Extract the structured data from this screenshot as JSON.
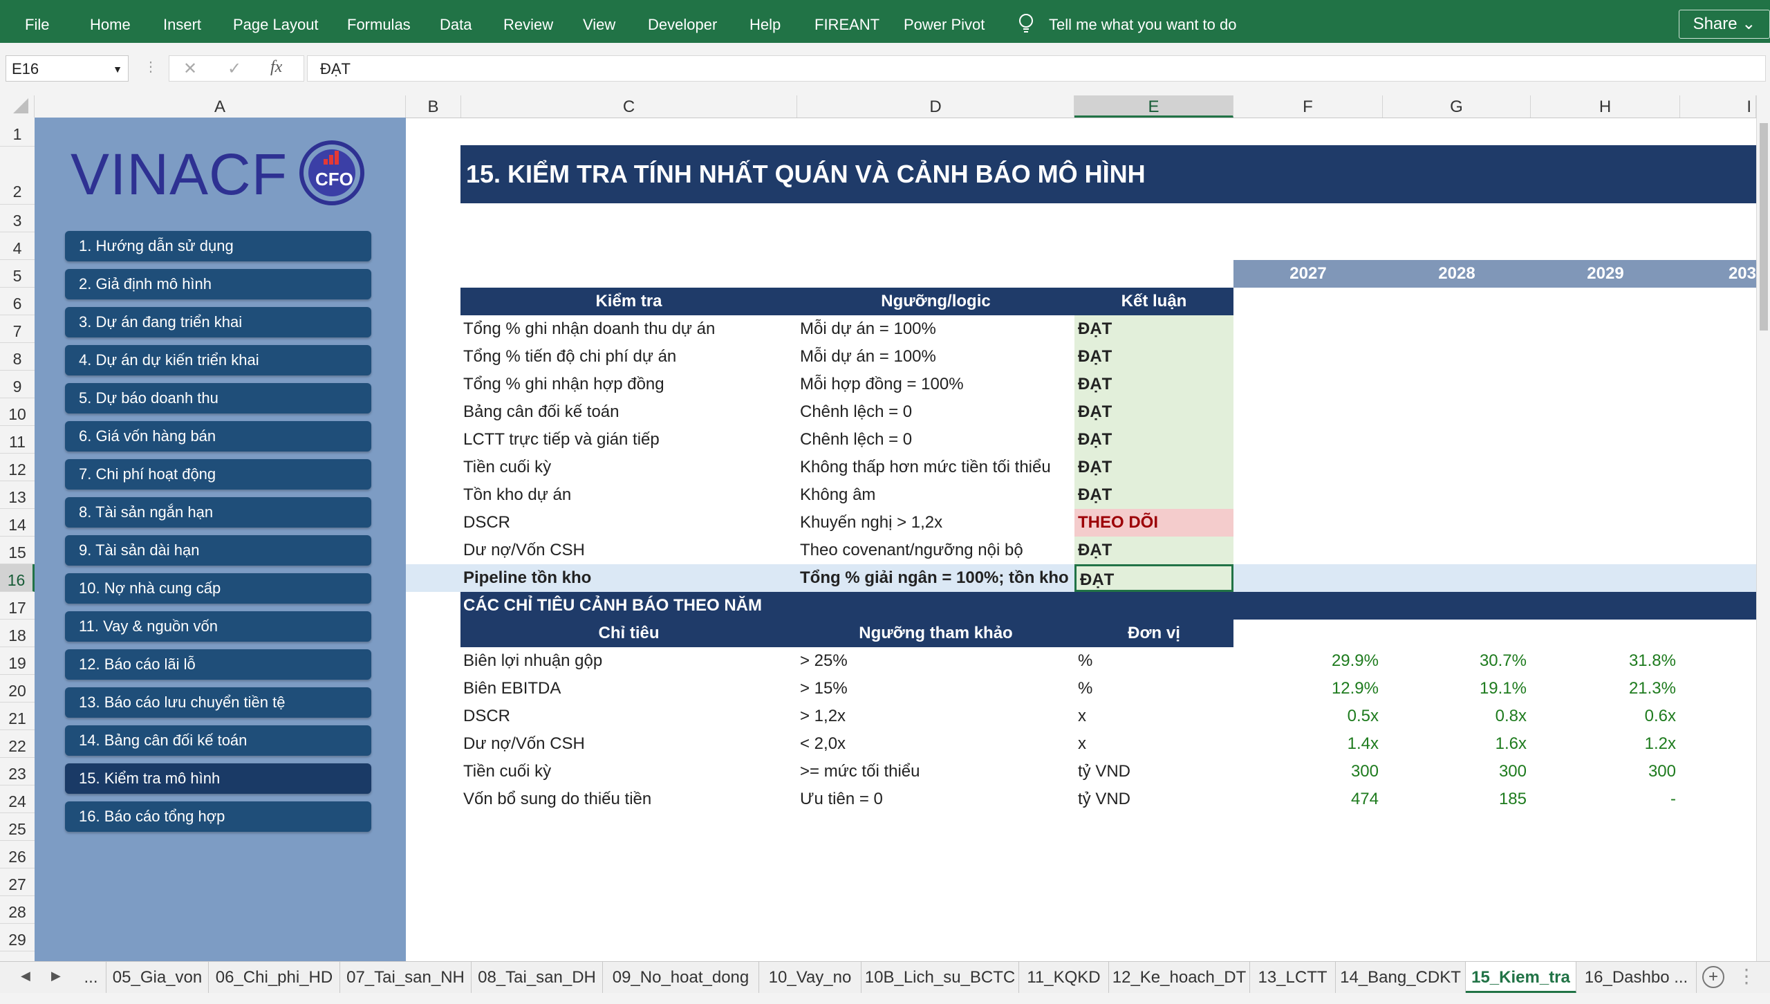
{
  "ribbon": {
    "tabs": [
      "File",
      "Home",
      "Insert",
      "Page Layout",
      "Formulas",
      "Data",
      "Review",
      "View",
      "Developer",
      "Help",
      "FIREANT",
      "Power Pivot"
    ],
    "tell_me": "Tell me what you want to do",
    "share": "Share"
  },
  "formula_bar": {
    "name_box": "E16",
    "fx": "fx",
    "value": "ĐẠT"
  },
  "columns": [
    "A",
    "B",
    "C",
    "D",
    "E",
    "F",
    "G",
    "H",
    "I"
  ],
  "rows": [
    "1",
    "2",
    "3",
    "4",
    "5",
    "6",
    "7",
    "8",
    "9",
    "10",
    "11",
    "12",
    "13",
    "14",
    "15",
    "16",
    "17",
    "18",
    "19",
    "20",
    "21",
    "22",
    "23",
    "24",
    "25",
    "26",
    "27",
    "28",
    "29"
  ],
  "sidebar": {
    "logo": "VINACF",
    "logo_badge": "CFO",
    "items": [
      "1. Hướng dẫn sử dụng",
      "2. Giả định mô hình",
      "3. Dự án đang triển khai",
      "4. Dự án dự kiến triển khai",
      "5. Dự báo doanh thu",
      "6. Giá vốn hàng bán",
      "7. Chi phí hoạt động",
      "8. Tài sản ngắn hạn",
      "9. Tài sản dài hạn",
      "10. Nợ nhà cung cấp",
      "11. Vay & nguồn vốn",
      "12. Báo cáo lãi lỗ",
      "13. Báo cáo lưu chuyển tiền tệ",
      "14. Bảng cân đối kế toán",
      "15. Kiểm tra mô hình",
      "16. Báo cáo tổng hợp"
    ]
  },
  "sheet": {
    "title": "15. KIỂM TRA TÍNH NHẤT QUÁN VÀ CẢNH BÁO MÔ HÌNH",
    "years": [
      "2027",
      "2028",
      "2029",
      "203"
    ],
    "check_headers": [
      "Kiểm tra",
      "Ngưỡng/logic",
      "Kết luận"
    ],
    "checks": [
      {
        "name": "Tổng % ghi nhận doanh thu dự án",
        "logic": "Mỗi dự án = 100%",
        "result": "ĐẠT"
      },
      {
        "name": "Tổng % tiến độ chi phí dự án",
        "logic": "Mỗi dự án = 100%",
        "result": "ĐẠT"
      },
      {
        "name": "Tổng % ghi nhận hợp đồng",
        "logic": "Mỗi hợp đồng = 100%",
        "result": "ĐẠT"
      },
      {
        "name": "Bảng cân đối kế toán",
        "logic": "Chênh lệch = 0",
        "result": "ĐẠT"
      },
      {
        "name": "LCTT trực tiếp và gián tiếp",
        "logic": "Chênh lệch = 0",
        "result": "ĐẠT"
      },
      {
        "name": "Tiền cuối kỳ",
        "logic": "Không thấp hơn mức tiền tối thiểu",
        "result": "ĐẠT"
      },
      {
        "name": "Tồn kho dự án",
        "logic": "Không âm",
        "result": "ĐẠT"
      },
      {
        "name": "DSCR",
        "logic": "Khuyến nghị > 1,2x",
        "result": "THEO DÕI"
      },
      {
        "name": "Dư nợ/Vốn CSH",
        "logic": "Theo covenant/ngưỡng nội bộ",
        "result": "ĐẠT"
      },
      {
        "name": "Pipeline tồn kho",
        "logic": "Tổng % giải ngân = 100%; tồn kho",
        "result": "ĐẠT"
      }
    ],
    "warning_title": "CÁC CHỈ TIÊU CẢNH BÁO THEO NĂM",
    "warning_headers": [
      "Chỉ tiêu",
      "Ngưỡng tham khảo",
      "Đơn vị"
    ],
    "warnings": [
      {
        "name": "Biên lợi nhuận gộp",
        "threshold": "> 25%",
        "unit": "%",
        "v": [
          "29.9%",
          "30.7%",
          "31.8%"
        ]
      },
      {
        "name": "Biên EBITDA",
        "threshold": "> 15%",
        "unit": "%",
        "v": [
          "12.9%",
          "19.1%",
          "21.3%"
        ]
      },
      {
        "name": "DSCR",
        "threshold": "> 1,2x",
        "unit": "x",
        "v": [
          "0.5x",
          "0.8x",
          "0.6x"
        ]
      },
      {
        "name": "Dư nợ/Vốn CSH",
        "threshold": "< 2,0x",
        "unit": "x",
        "v": [
          "1.4x",
          "1.6x",
          "1.2x"
        ]
      },
      {
        "name": "Tiền cuối kỳ",
        "threshold": ">= mức tối thiểu",
        "unit": "tỷ VND",
        "v": [
          "300",
          "300",
          "300"
        ]
      },
      {
        "name": "Vốn bổ sung do thiếu tiền",
        "threshold": "Ưu tiên = 0",
        "unit": "tỷ VND",
        "v": [
          "474",
          "185",
          "-"
        ]
      }
    ]
  },
  "sheet_tabs": [
    "...",
    "05_Gia_von",
    "06_Chi_phi_HD",
    "07_Tai_san_NH",
    "08_Tai_san_DH",
    "09_No_hoat_dong",
    "10_Vay_no",
    "10B_Lich_su_BCTC",
    "11_KQKD",
    "12_Ke_hoach_DT",
    "13_LCTT",
    "14_Bang_CDKT",
    "15_Kiem_tra",
    "16_Dashbo ..."
  ],
  "colors": {
    "ribbon": "#217346",
    "header_navy": "#1f3b69",
    "sidebar": "#7d9cc4",
    "pass": "#e2efda",
    "warn": "#f4cccc"
  }
}
